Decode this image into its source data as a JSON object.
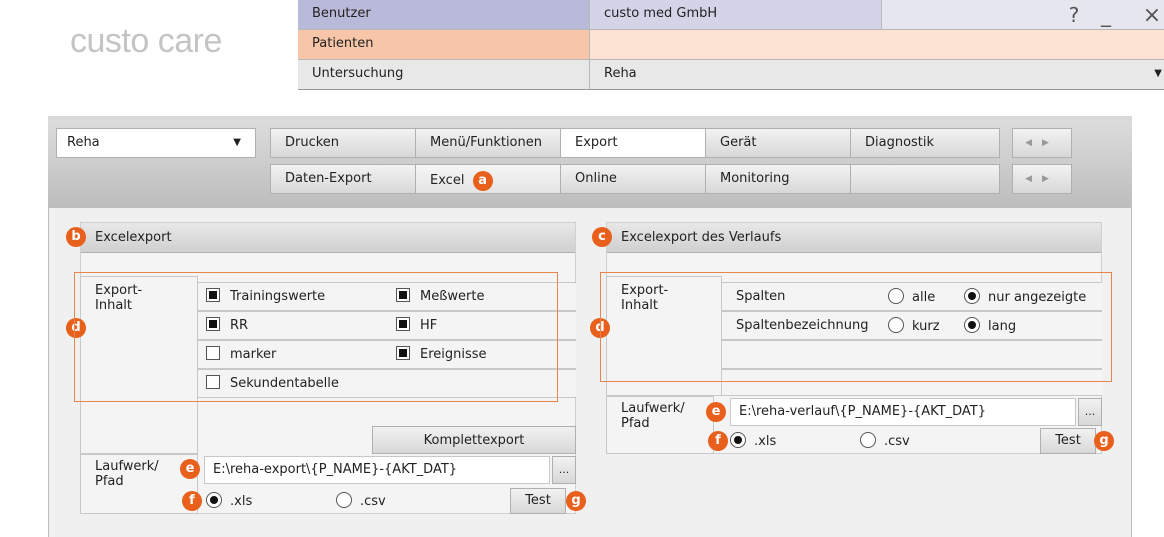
{
  "app": {
    "logo": "custo care"
  },
  "header": {
    "rows": [
      {
        "label": "Benutzer",
        "value": "custo med GmbH"
      },
      {
        "label": "Patienten",
        "value": ""
      },
      {
        "label": "Untersuchung",
        "value": "Reha"
      }
    ],
    "help_label": "?",
    "minimize_label": "_",
    "close_label": "×"
  },
  "module_select": {
    "value": "Reha"
  },
  "tabs_row1": [
    "Drucken",
    "Menü/Funktionen",
    "Export",
    "Gerät",
    "Diagnostik"
  ],
  "tabs_row2": [
    "Daten-Export",
    "Excel",
    "Online",
    "Monitoring",
    ""
  ],
  "badges": {
    "a": "a",
    "b": "b",
    "c": "c",
    "d": "d",
    "e": "e",
    "f": "f",
    "g": "g"
  },
  "left": {
    "title": "Excelexport",
    "export_label": "Export-\nInhalt",
    "items": [
      {
        "label": "Trainingswerte",
        "checked": true
      },
      {
        "label": "Meßwerte",
        "checked": true
      },
      {
        "label": "RR",
        "checked": true
      },
      {
        "label": "HF",
        "checked": true
      },
      {
        "label": "marker",
        "checked": false
      },
      {
        "label": "Ereignisse",
        "checked": true
      },
      {
        "label": "Sekundentabelle",
        "checked": false
      }
    ],
    "full_export_label": "Komplettexport",
    "path_label": "Laufwerk/\nPfad",
    "path_value": "E:\\reha-export\\{P_NAME}-{AKT_DAT}",
    "browse_label": "...",
    "fmt_xls": ".xls",
    "fmt_csv": ".csv",
    "test_label": "Test"
  },
  "right": {
    "title": "Excelexport des Verlaufs",
    "export_label": "Export-\nInhalt",
    "columns_label": "Spalten",
    "columns_all": "alle",
    "columns_shown": "nur angezeigte",
    "colname_label": "Spaltenbezeichnung",
    "colname_short": "kurz",
    "colname_long": "lang",
    "path_label": "Laufwerk/\nPfad",
    "path_value": "E:\\reha-verlauf\\{P_NAME}-{AKT_DAT}",
    "browse_label": "...",
    "fmt_xls": ".xls",
    "fmt_csv": ".csv",
    "test_label": "Test"
  },
  "colors": {
    "accent": "#e8601c",
    "user_row": "#b9b9da",
    "patient_row": "#f7c6a8"
  }
}
